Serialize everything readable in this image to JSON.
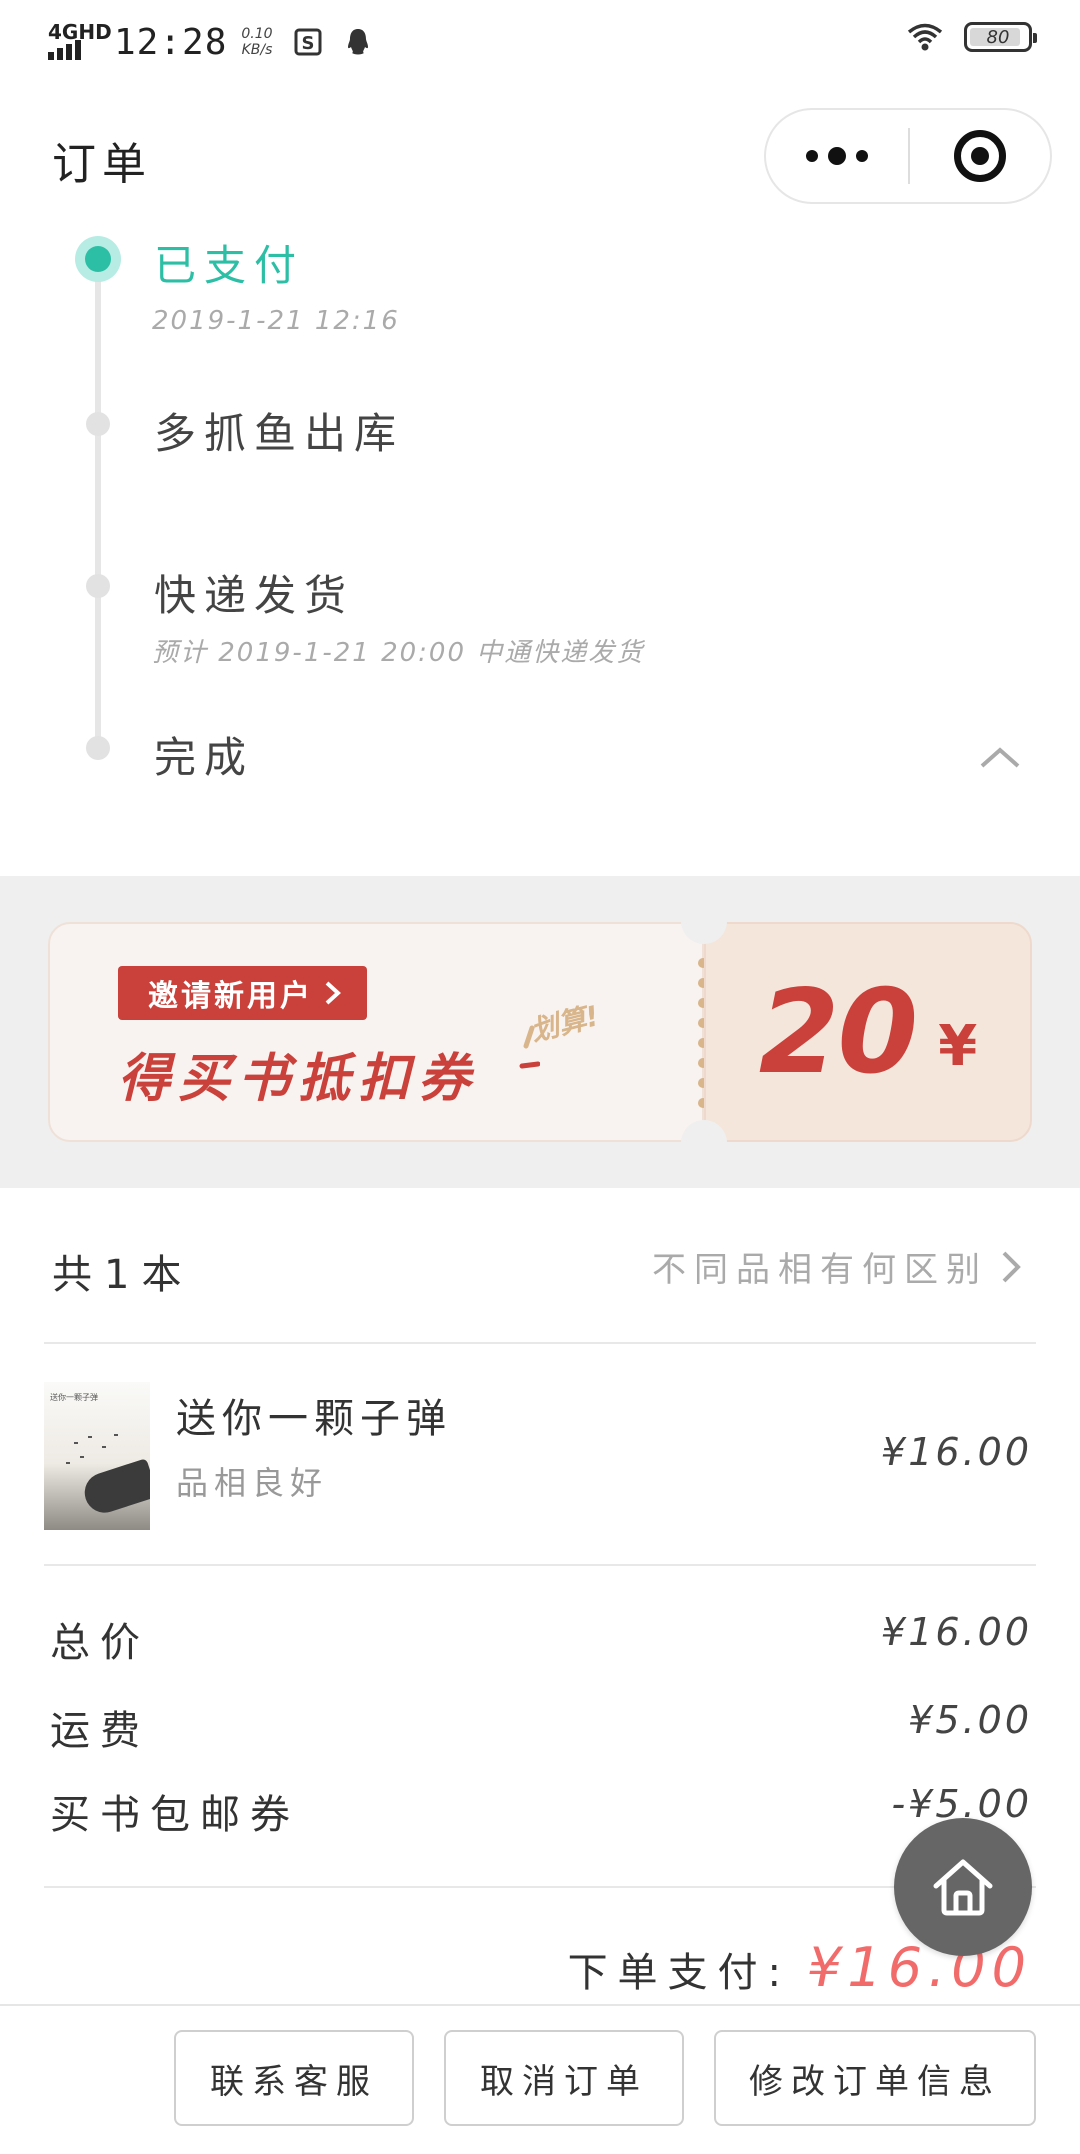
{
  "status_bar": {
    "network": "4GHD",
    "time": "12:28",
    "speed_value": "0.10",
    "speed_unit": "KB/s",
    "battery": "80"
  },
  "nav": {
    "title": "订单"
  },
  "timeline": {
    "steps": [
      {
        "title": "已支付",
        "subtitle": "2019-1-21  12:16",
        "active": true
      },
      {
        "title": "多抓鱼出库",
        "subtitle": ""
      },
      {
        "title": "快递发货",
        "subtitle": "预计 2019-1-21  20:00 中通快递发货"
      },
      {
        "title": "完成",
        "subtitle": ""
      }
    ]
  },
  "banner": {
    "tag": "邀请新用户",
    "main": "得买书抵扣券",
    "stamp": "划算!",
    "amount": "20",
    "currency": "¥",
    "accent_color": "#c9413a"
  },
  "books": {
    "count_label": "共1本",
    "condition_link": "不同品相有何区别",
    "items": [
      {
        "title": "送你一颗子弹",
        "condition": "品相良好",
        "price": "¥16.00",
        "cover_text": "送你一颗子弹"
      }
    ]
  },
  "totals": {
    "rows": [
      {
        "label": "总价",
        "value": "¥16.00"
      },
      {
        "label": "运费",
        "value": "¥5.00"
      },
      {
        "label": "买书包邮券",
        "value": "-¥5.00"
      }
    ],
    "pay_label": "下单支付:",
    "pay_value": "¥16.00",
    "pay_color": "#f26b6b"
  },
  "actions": {
    "contact": "联系客服",
    "cancel": "取消订单",
    "modify": "修改订单信息"
  },
  "theme": {
    "accent": "#2dbfa6"
  }
}
